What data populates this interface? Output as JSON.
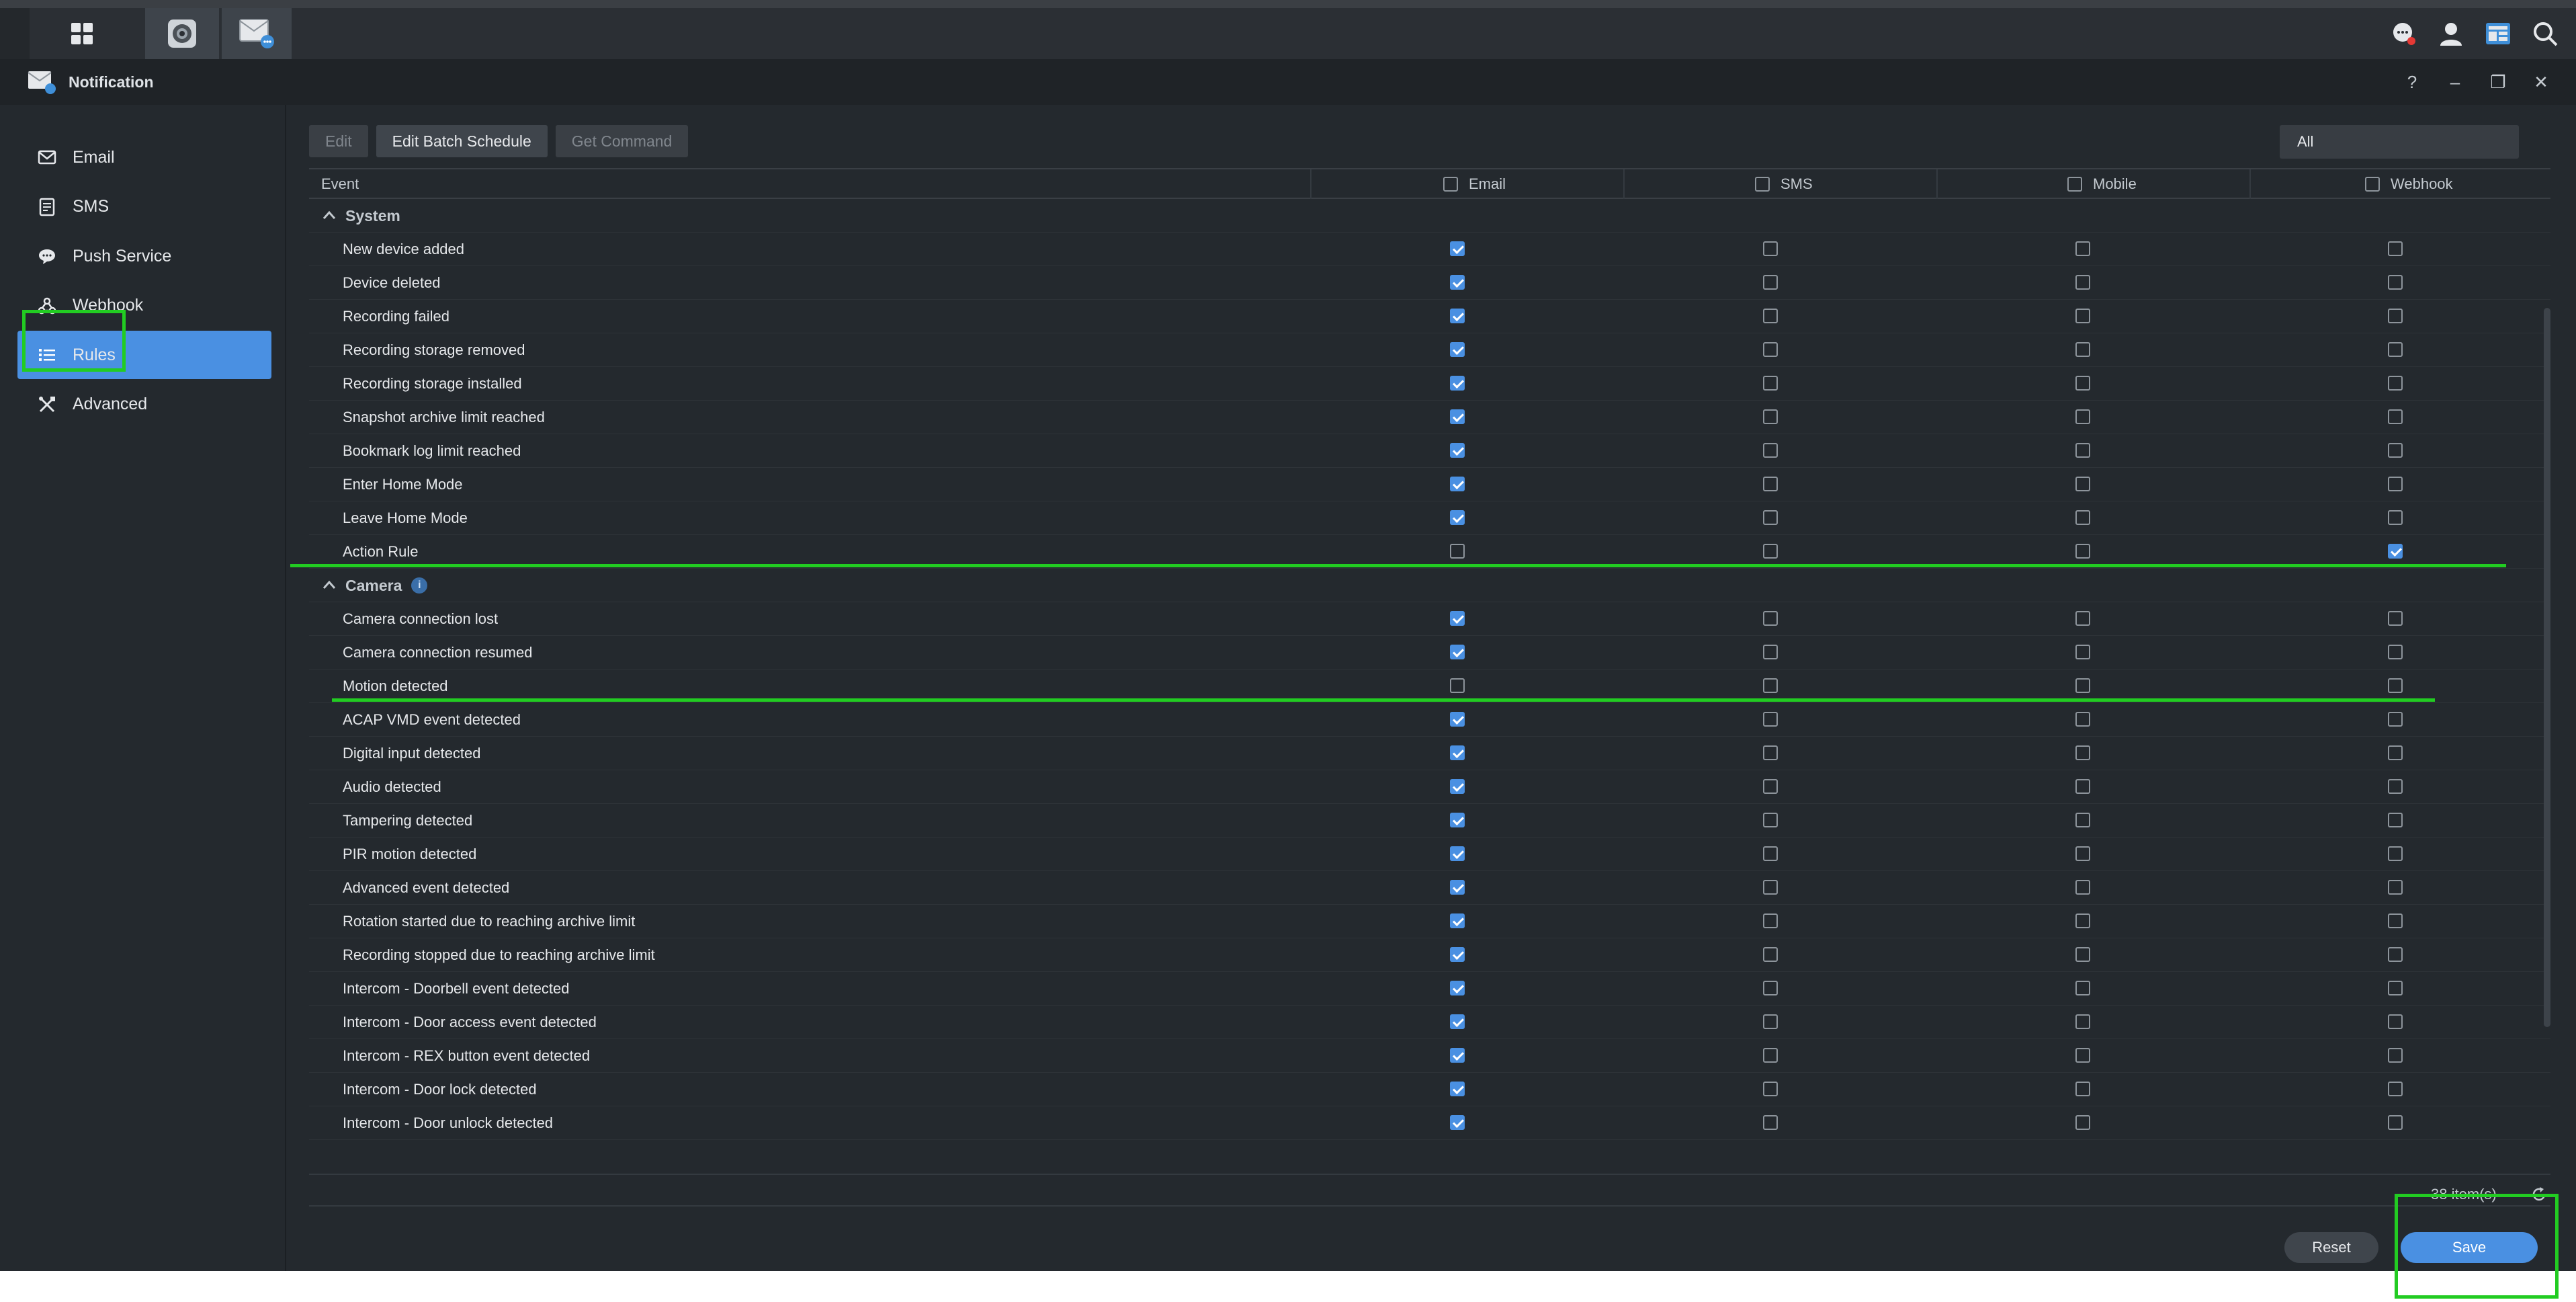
{
  "window": {
    "title": "Notification"
  },
  "taskbar": {
    "left_icons": [
      "apps-grid-icon",
      "surveillance-camera-icon",
      "notification-app-icon"
    ],
    "right_icons": [
      "chat-notification-icon",
      "user-icon",
      "widgets-icon",
      "search-icon"
    ]
  },
  "window_controls": [
    "help-icon",
    "minimize-icon",
    "restore-icon",
    "close-icon"
  ],
  "window_controls_glyphs": [
    "?",
    "–",
    "❐",
    "✕"
  ],
  "sidebar": {
    "items": [
      {
        "label": "Email",
        "icon": "envelope-icon"
      },
      {
        "label": "SMS",
        "icon": "sms-icon"
      },
      {
        "label": "Push Service",
        "icon": "chat-bubble-icon"
      },
      {
        "label": "Webhook",
        "icon": "webhook-icon"
      },
      {
        "label": "Rules",
        "icon": "list-icon",
        "active": true
      },
      {
        "label": "Advanced",
        "icon": "tools-icon"
      }
    ]
  },
  "toolbar": {
    "edit_label": "Edit",
    "edit_batch_label": "Edit Batch Schedule",
    "get_command_label": "Get Command",
    "filter_value": "All"
  },
  "grid": {
    "columns": {
      "event": "Event",
      "email": "Email",
      "sms": "SMS",
      "mobile": "Mobile",
      "webhook": "Webhook"
    },
    "groups": [
      {
        "name": "System",
        "info": false,
        "rows": [
          {
            "event": "New device added",
            "email": true,
            "sms": false,
            "mobile": false,
            "webhook": false
          },
          {
            "event": "Device deleted",
            "email": true,
            "sms": false,
            "mobile": false,
            "webhook": false
          },
          {
            "event": "Recording failed",
            "email": true,
            "sms": false,
            "mobile": false,
            "webhook": false
          },
          {
            "event": "Recording storage removed",
            "email": true,
            "sms": false,
            "mobile": false,
            "webhook": false
          },
          {
            "event": "Recording storage installed",
            "email": true,
            "sms": false,
            "mobile": false,
            "webhook": false
          },
          {
            "event": "Snapshot archive limit reached",
            "email": true,
            "sms": false,
            "mobile": false,
            "webhook": false
          },
          {
            "event": "Bookmark log limit reached",
            "email": true,
            "sms": false,
            "mobile": false,
            "webhook": false
          },
          {
            "event": "Enter Home Mode",
            "email": true,
            "sms": false,
            "mobile": false,
            "webhook": false
          },
          {
            "event": "Leave Home Mode",
            "email": true,
            "sms": false,
            "mobile": false,
            "webhook": false
          },
          {
            "event": "Action Rule",
            "email": false,
            "sms": false,
            "mobile": false,
            "webhook": true
          }
        ]
      },
      {
        "name": "Camera",
        "info": true,
        "info_glyph": "i",
        "rows": [
          {
            "event": "Camera connection lost",
            "email": true,
            "sms": false,
            "mobile": false,
            "webhook": false
          },
          {
            "event": "Camera connection resumed",
            "email": true,
            "sms": false,
            "mobile": false,
            "webhook": false
          },
          {
            "event": "Motion detected",
            "email": false,
            "sms": false,
            "mobile": false,
            "webhook": false
          },
          {
            "event": "ACAP VMD event detected",
            "email": true,
            "sms": false,
            "mobile": false,
            "webhook": false
          },
          {
            "event": "Digital input detected",
            "email": true,
            "sms": false,
            "mobile": false,
            "webhook": false
          },
          {
            "event": "Audio detected",
            "email": true,
            "sms": false,
            "mobile": false,
            "webhook": false
          },
          {
            "event": "Tampering detected",
            "email": true,
            "sms": false,
            "mobile": false,
            "webhook": false
          },
          {
            "event": "PIR motion detected",
            "email": true,
            "sms": false,
            "mobile": false,
            "webhook": false
          },
          {
            "event": "Advanced event detected",
            "email": true,
            "sms": false,
            "mobile": false,
            "webhook": false
          },
          {
            "event": "Rotation started due to reaching archive limit",
            "email": true,
            "sms": false,
            "mobile": false,
            "webhook": false
          },
          {
            "event": "Recording stopped due to reaching archive limit",
            "email": true,
            "sms": false,
            "mobile": false,
            "webhook": false
          },
          {
            "event": "Intercom - Doorbell event detected",
            "email": true,
            "sms": false,
            "mobile": false,
            "webhook": false
          },
          {
            "event": "Intercom - Door access event detected",
            "email": true,
            "sms": false,
            "mobile": false,
            "webhook": false
          },
          {
            "event": "Intercom - REX button event detected",
            "email": true,
            "sms": false,
            "mobile": false,
            "webhook": false
          },
          {
            "event": "Intercom - Door lock detected",
            "email": true,
            "sms": false,
            "mobile": false,
            "webhook": false
          },
          {
            "event": "Intercom - Door unlock detected",
            "email": true,
            "sms": false,
            "mobile": false,
            "webhook": false
          }
        ]
      }
    ],
    "item_count": "38 item(s)"
  },
  "footer": {
    "reset_label": "Reset",
    "save_label": "Save"
  },
  "colors": {
    "accent": "#4a90e2",
    "annotation": "#22cc22",
    "background": "#24292e"
  }
}
